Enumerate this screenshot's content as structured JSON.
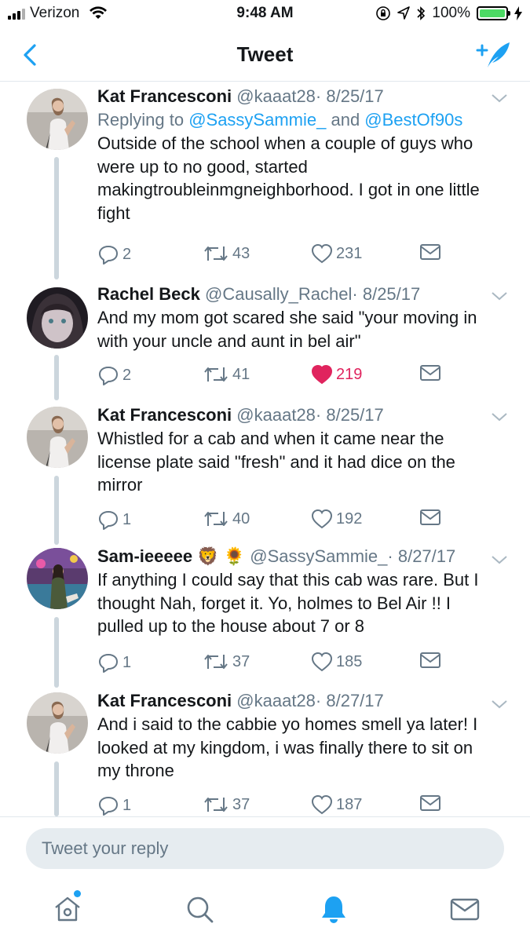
{
  "status_bar": {
    "carrier": "Verizon",
    "time": "9:48 AM",
    "battery": "100%"
  },
  "nav": {
    "title": "Tweet"
  },
  "colors": {
    "accent": "#1da1f2",
    "like": "#e0245e",
    "muted": "#657786",
    "thread_line": "#ccd6dd",
    "input_bg": "#e6ecf0"
  },
  "tweets": [
    {
      "name": "Kat Francesconi",
      "handle": "@kaaat28",
      "date": "· 8/25/17",
      "replying_prefix": "Replying to ",
      "replying_user1": "@SassySammie_",
      "replying_and": " and ",
      "replying_user2": "@BestOf90s",
      "text": "Outside of the school when a couple of guys who were up to no good, started makingtroubleinmgneighborhood. I got in one little fight",
      "replies": "2",
      "retweets": "43",
      "likes": "231",
      "liked": false
    },
    {
      "name": "Rachel Beck",
      "handle": "@Causally_Rachel",
      "date": "· 8/25/17",
      "text": "And my mom got scared she said \"your moving in with your uncle and aunt in bel air\"",
      "replies": "2",
      "retweets": "41",
      "likes": "219",
      "liked": true
    },
    {
      "name": "Kat Francesconi",
      "handle": "@kaaat28",
      "date": "· 8/25/17",
      "text": "Whistled for a cab and when it came near the license plate said \"fresh\" and it had dice on the mirror",
      "replies": "1",
      "retweets": "40",
      "likes": "192",
      "liked": false
    },
    {
      "name": "Sam-ieeeee 🦁 🌻",
      "handle": "@SassySammie_",
      "date": "· 8/27/17",
      "text": "If anything I could say that this cab was rare. But I thought Nah, forget it. Yo, holmes to Bel Air !! I pulled up to the house about 7 or 8",
      "replies": "1",
      "retweets": "37",
      "likes": "185",
      "liked": false
    },
    {
      "name": "Kat Francesconi",
      "handle": "@kaaat28",
      "date": "· 8/27/17",
      "text": "And i said to the cabbie yo homes smell ya later! I looked at my kingdom, i was finally there to sit on my throne",
      "replies": "1",
      "retweets": "37",
      "likes": "187",
      "liked": false
    }
  ],
  "reply_bar": {
    "placeholder": "Tweet your reply"
  },
  "tab_bar": {
    "icons": [
      "home-icon",
      "search-icon",
      "notifications-icon",
      "messages-icon"
    ],
    "active": "notifications-icon"
  }
}
